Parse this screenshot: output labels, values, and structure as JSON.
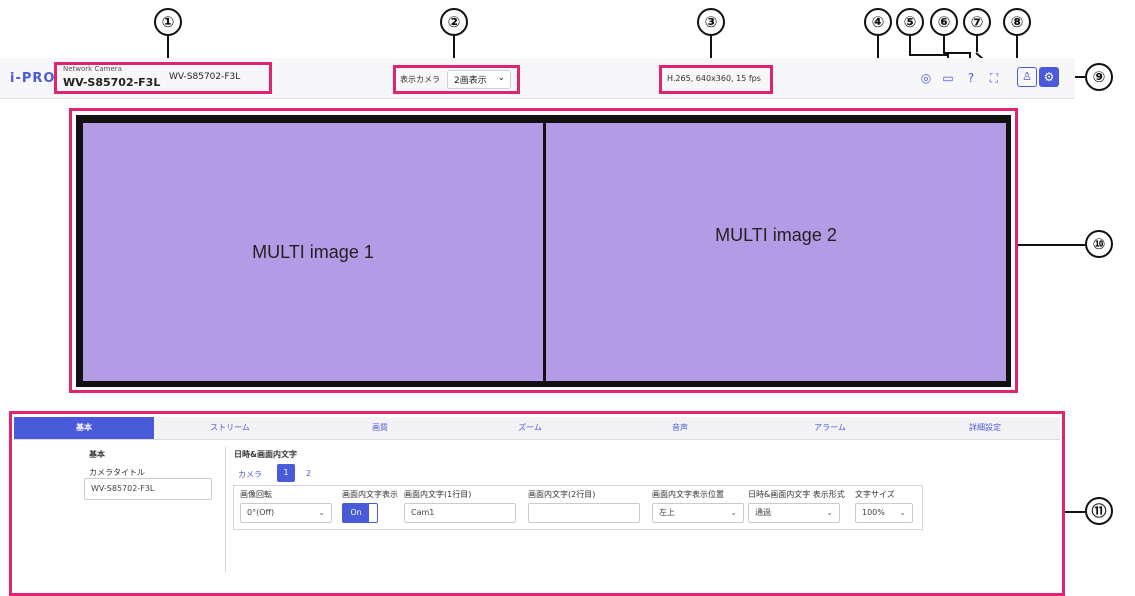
{
  "callouts": [
    "①",
    "②",
    "③",
    "④",
    "⑤",
    "⑥",
    "⑦",
    "⑧",
    "⑨",
    "⑩",
    "⑪"
  ],
  "header": {
    "logo": "i-PRO",
    "camera_type": "Network Camera",
    "model": "WV-S85702-F3L",
    "camera_title": "WV-S85702-F3L",
    "display_camera_label": "表示カメラ",
    "display_camera_value": "2画表示",
    "stream_info": "H.265, 640x360, 15 fps"
  },
  "icons": [
    "camera-snapshot-icon",
    "video-record-icon",
    "help-icon",
    "fullscreen-icon",
    "live-user-icon",
    "settings-icon"
  ],
  "images": {
    "image1": "MULTI image 1",
    "image2": "MULTI image 2"
  },
  "tabs": [
    "基本",
    "ストリーム",
    "画質",
    "ズーム",
    "音声",
    "アラーム",
    "詳細設定"
  ],
  "left_panel": {
    "heading": "基本",
    "camera_title_label": "カメラタイトル",
    "camera_title_value": "WV-S85702-F3L"
  },
  "osd": {
    "heading": "日時&画面内文字",
    "camera_label": "カメラ",
    "camera_1": "1",
    "camera_2": "2",
    "cols": [
      "画像回転",
      "画面内文字表示",
      "画面内文字(1行目)",
      "画面内文字(2行目)",
      "画面内文字表示位置",
      "日時&画面内文字 表示形式",
      "文字サイズ"
    ],
    "rotation": "0°(Off)",
    "toggle": "On",
    "line1": "Cam1",
    "line2": "",
    "position": "左上",
    "format": "通過",
    "size": "100%"
  },
  "colors": {
    "accent": "#4a5bd9",
    "highlight": "#e0246f",
    "image_fill": "#b49be6"
  }
}
